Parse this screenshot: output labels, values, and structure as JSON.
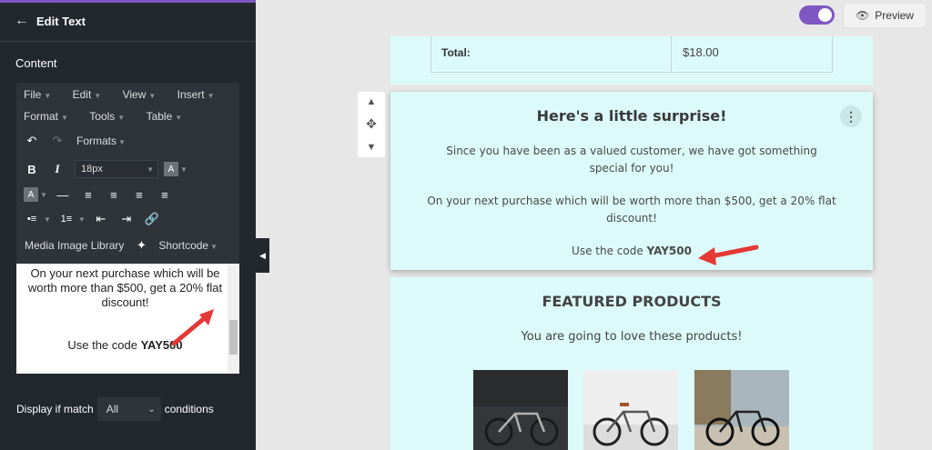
{
  "panel": {
    "title": "Edit Text",
    "content_label": "Content",
    "menu": [
      "File",
      "Edit",
      "View",
      "Insert",
      "Format",
      "Tools",
      "Table"
    ],
    "formats_label": "Formats",
    "font_size": "18px",
    "media_label": "Media Image Library",
    "shortcode_label": "Shortcode",
    "editor_text": {
      "para": "On your next purchase which will be worth more than $500, get a 20% flat discount!",
      "code_prefix": "Use the code ",
      "code": "YAY500"
    },
    "condition": {
      "prefix": "Display if match",
      "value": "All",
      "suffix": "conditions"
    }
  },
  "toolbar": {
    "preview_label": "Preview"
  },
  "email": {
    "total_label": "Total:",
    "total_value": "$18.00",
    "surprise_title": "Here's a little surprise!",
    "surprise_line1": "Since you have been as a valued customer, we have got something special for you!",
    "surprise_line2": "On your next purchase which will be worth more than $500, get a 20% flat discount!",
    "code_prefix": "Use the code ",
    "code": "YAY500",
    "featured_title": "FEATURED PRODUCTS",
    "featured_sub": "You are going to love these products!"
  },
  "colors": {
    "accent": "#7e57c2",
    "panel_bg": "#23282d",
    "email_bg": "#dcfafa",
    "arrow": "#e53935"
  }
}
